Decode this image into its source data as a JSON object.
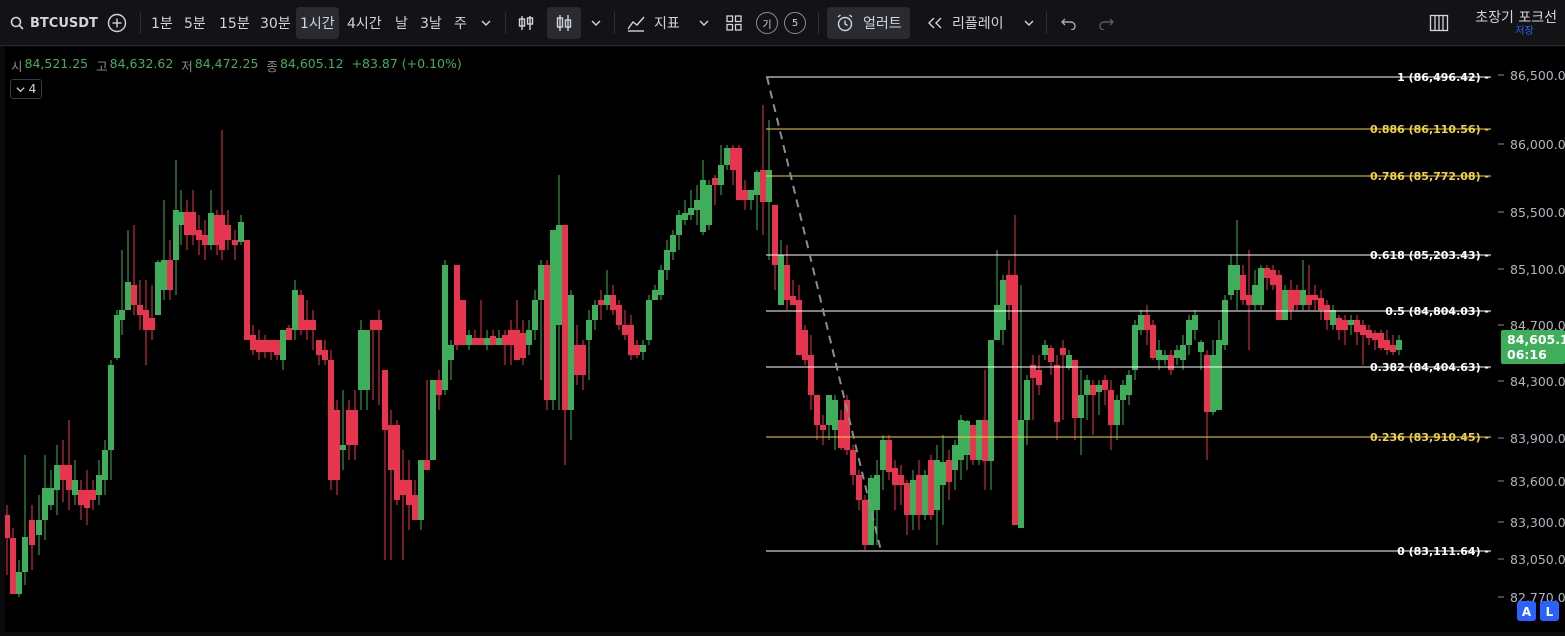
{
  "toolbar": {
    "symbol": "BTCUSDT",
    "intervals": [
      "1분",
      "5분",
      "15분",
      "30분",
      "1시간",
      "4시간",
      "날",
      "3날",
      "주"
    ],
    "active_interval": "1시간",
    "indicators_label": "지표",
    "templates_badge": "기",
    "templates_count": "5",
    "alert_label": "얼러트",
    "replay_label": "리플레이",
    "layout_name": "초장기 포크선",
    "save_label": "저장"
  },
  "ohlc": {
    "open_label": "시",
    "open": "84,521.25",
    "high_label": "고",
    "high": "84,632.62",
    "low_label": "저",
    "low": "84,472.25",
    "close_label": "종",
    "close": "84,605.12",
    "change": "+83.87 (+0.10%)"
  },
  "collapse_badge": "4",
  "price_axis": {
    "ticks": [
      "86,500.00",
      "86,000.00",
      "85,500.00",
      "85,100.00",
      "84,700.00",
      "84,300.00",
      "83,900.00",
      "83,600.00",
      "83,300.00",
      "83,050.00",
      "82,770.00"
    ],
    "current_price": "84,605.12",
    "countdown": "06:16",
    "current_color": "#3fae5a"
  },
  "fib_levels": [
    {
      "label": "1 (86,496.42)",
      "color": "#ffffff"
    },
    {
      "label": "0.886 (86,110.56)",
      "color": "#f1d43c"
    },
    {
      "label": "0.786 (85,772.08)",
      "color": "#f1d43c"
    },
    {
      "label": "0.618 (85,203.43)",
      "color": "#ffffff"
    },
    {
      "label": "0.5 (84,804.03)",
      "color": "#ffffff"
    },
    {
      "label": "0.382 (84,404.63)",
      "color": "#ffffff"
    },
    {
      "label": "0.236 (83,910.45)",
      "color": "#f1d43c"
    },
    {
      "label": "0 (83,111.64)",
      "color": "#ffffff"
    }
  ],
  "corner_buttons": {
    "auto": "A",
    "log": "L"
  },
  "colors": {
    "up": "#3fae5a",
    "down": "#e8354f",
    "accent": "#2962ff",
    "background": "#000000"
  }
}
